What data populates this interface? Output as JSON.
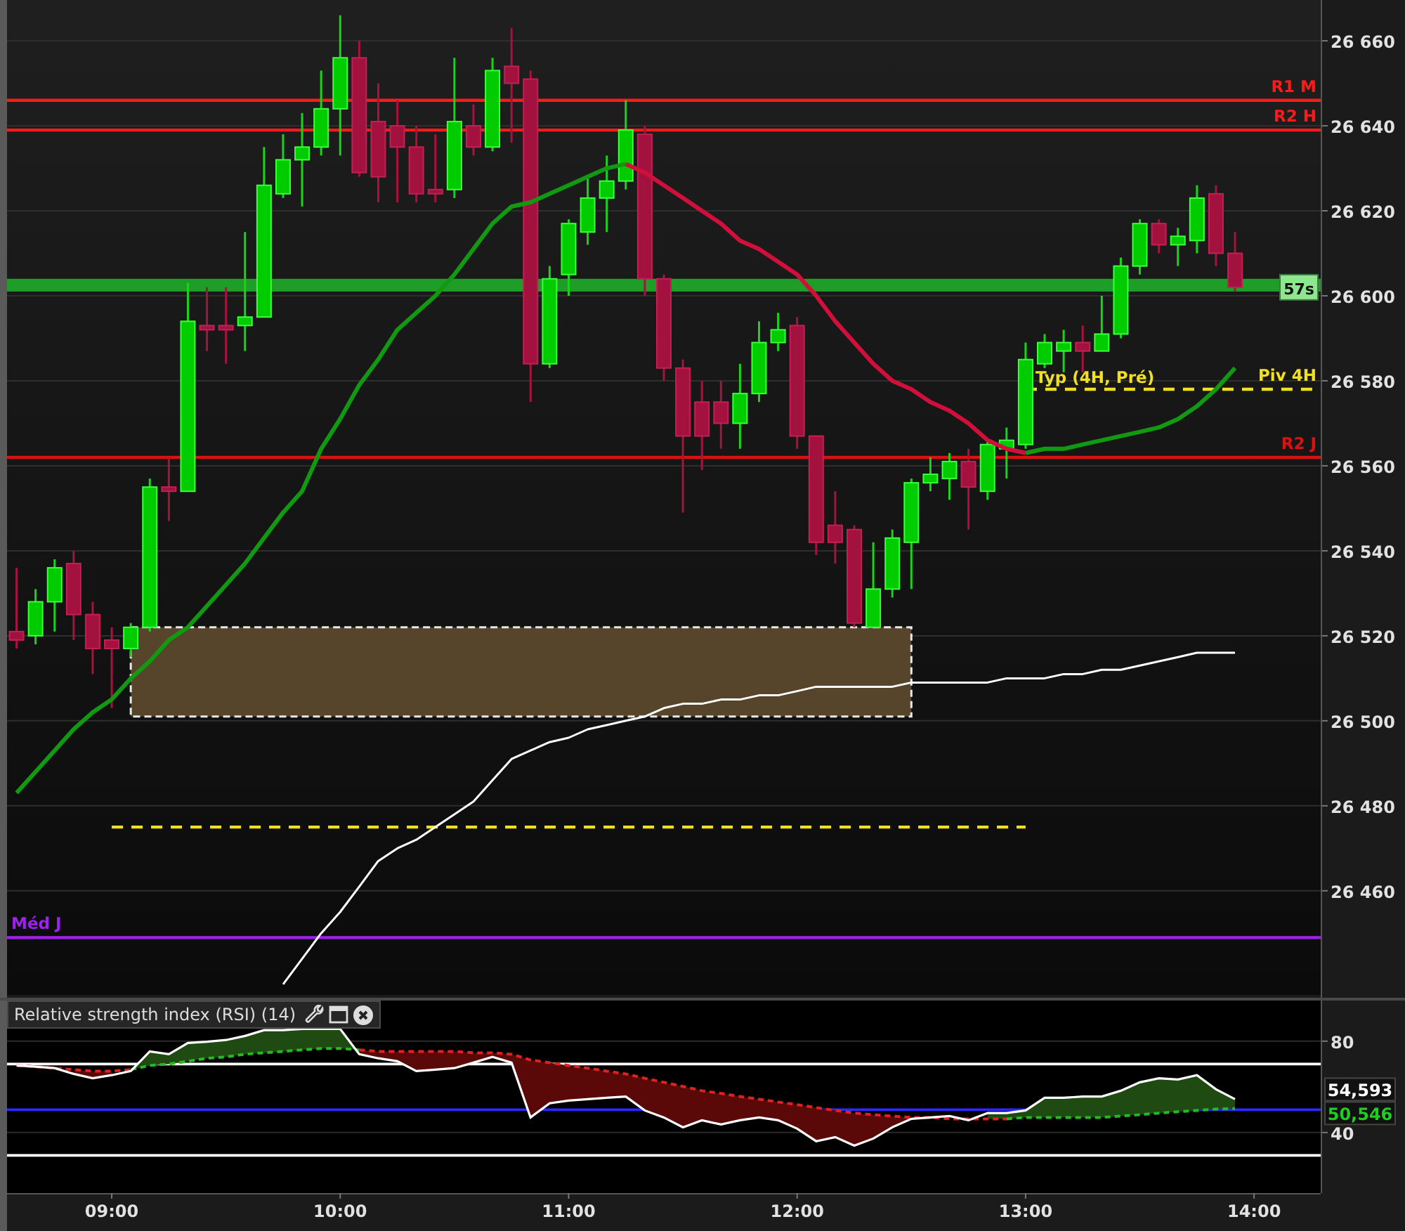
{
  "price_chart": {
    "countdown": {
      "text": "57s"
    },
    "chart_data": {
      "type": "candlestick",
      "grid": true,
      "x": [
        515,
        520,
        525,
        530,
        535,
        540,
        545,
        550,
        555,
        560,
        565,
        570,
        575,
        580,
        585,
        590,
        595,
        600,
        605,
        610,
        615,
        620,
        625,
        630,
        635,
        640,
        645,
        650,
        655,
        660,
        665,
        670,
        675,
        680,
        685,
        690,
        695,
        700,
        705,
        710,
        715,
        720,
        725,
        730,
        735,
        740,
        745,
        750,
        755,
        760,
        765,
        770,
        775,
        780,
        785,
        790,
        795,
        800,
        805,
        810,
        815,
        820,
        825,
        830,
        835
      ],
      "xlim": [
        512.5,
        857.5
      ],
      "ylim": [
        26435.5,
        26669.6
      ],
      "yticks": [
        {
          "value": 26660,
          "label": "26 660"
        },
        {
          "value": 26640,
          "label": "26 640"
        },
        {
          "value": 26620,
          "label": "26 620"
        },
        {
          "value": 26600,
          "label": "26 600"
        },
        {
          "value": 26580,
          "label": "26 580"
        },
        {
          "value": 26560,
          "label": "26 560"
        },
        {
          "value": 26540,
          "label": "26 540"
        },
        {
          "value": 26520,
          "label": "26 520"
        },
        {
          "value": 26500,
          "label": "26 500"
        },
        {
          "value": 26480,
          "label": "26 480"
        },
        {
          "value": 26460,
          "label": "26 460"
        }
      ],
      "ohlc": [
        [
          26521,
          26536,
          26517,
          26519
        ],
        [
          26520,
          26531,
          26518,
          26528
        ],
        [
          26528,
          26538,
          26521,
          26536
        ],
        [
          26537,
          26540,
          26519,
          26525
        ],
        [
          26525,
          26528,
          26511,
          26517
        ],
        [
          26519,
          26522,
          26503,
          26517
        ],
        [
          26517,
          26523,
          26515,
          26522
        ],
        [
          26522,
          26557,
          26521,
          26555
        ],
        [
          26555,
          26562,
          26547,
          26554
        ],
        [
          26554,
          26603,
          26554,
          26594
        ],
        [
          26593,
          26602,
          26587,
          26592
        ],
        [
          26593,
          26602,
          26584,
          26592
        ],
        [
          26593,
          26615,
          26587,
          26595
        ],
        [
          26595,
          26635,
          26595,
          26626
        ],
        [
          26624,
          26638,
          26623,
          26632
        ],
        [
          26632,
          26643,
          26621,
          26635
        ],
        [
          26635,
          26653,
          26633,
          26644
        ],
        [
          26644,
          26666,
          26633,
          26656
        ],
        [
          26656,
          26660,
          26628,
          26629
        ],
        [
          26641,
          26650,
          26622,
          26628
        ],
        [
          26640,
          26646,
          26622,
          26635
        ],
        [
          26635,
          26640,
          26622,
          26624
        ],
        [
          26625,
          26638,
          26622,
          26624
        ],
        [
          26625,
          26656,
          26623,
          26641
        ],
        [
          26640,
          26645,
          26633,
          26635
        ],
        [
          26635,
          26656,
          26634,
          26653
        ],
        [
          26654,
          26663,
          26636,
          26650
        ],
        [
          26651,
          26653,
          26575,
          26584
        ],
        [
          26584,
          26607,
          26583,
          26604
        ],
        [
          26605,
          26618,
          26600,
          26617
        ],
        [
          26615,
          26628,
          26612,
          26623
        ],
        [
          26623,
          26633,
          26615,
          26627
        ],
        [
          26627,
          26646,
          26625,
          26639
        ],
        [
          26638,
          26640,
          26600,
          26604
        ],
        [
          26604,
          26605,
          26580,
          26583
        ],
        [
          26583,
          26585,
          26549,
          26567
        ],
        [
          26575,
          26580,
          26559,
          26567
        ],
        [
          26575,
          26580,
          26564,
          26570
        ],
        [
          26570,
          26584,
          26564,
          26577
        ],
        [
          26577,
          26594,
          26575,
          26589
        ],
        [
          26589,
          26596,
          26587,
          26592
        ],
        [
          26593,
          26595,
          26564,
          26567
        ],
        [
          26567,
          26567,
          26539,
          26542
        ],
        [
          26546,
          26554,
          26537,
          26542
        ],
        [
          26545,
          26546,
          26522,
          26523
        ],
        [
          26522,
          26542,
          26522,
          26531
        ],
        [
          26531,
          26545,
          26529,
          26543
        ],
        [
          26542,
          26557,
          26531,
          26556
        ],
        [
          26556,
          26562,
          26554,
          26558
        ],
        [
          26557,
          26563,
          26552,
          26561
        ],
        [
          26561,
          26564,
          26545,
          26555
        ],
        [
          26554,
          26566,
          26552,
          26565
        ],
        [
          26564,
          26569,
          26557,
          26566
        ],
        [
          26565,
          26589,
          26564,
          26585
        ],
        [
          26584,
          26591,
          26583,
          26589
        ],
        [
          26587,
          26592,
          26582,
          26589
        ],
        [
          26589,
          26593,
          26582,
          26587
        ],
        [
          26587,
          26600,
          26587,
          26591
        ],
        [
          26591,
          26609,
          26590,
          26607
        ],
        [
          26607,
          26618,
          26605,
          26617
        ],
        [
          26617,
          26618,
          26610,
          26612
        ],
        [
          26612,
          26616,
          26607,
          26614
        ],
        [
          26613,
          26626,
          26610,
          26623
        ],
        [
          26624,
          26626,
          26607,
          26610
        ],
        [
          26610,
          26615,
          26601,
          26602
        ]
      ],
      "series": [
        {
          "type": "line",
          "color": "#119a11",
          "values": [
            26483,
            26488,
            26493,
            26498,
            26502,
            26505,
            26510,
            26514,
            26519,
            26522,
            26527,
            26532,
            26537,
            26543,
            26549,
            26554,
            26564,
            26571,
            26579,
            26585,
            26592,
            26596,
            26600,
            26605,
            26611,
            26617,
            26621,
            26622,
            26624,
            26626,
            26628,
            26630,
            26631,
            null,
            null,
            null,
            null,
            null,
            null,
            null,
            null,
            null,
            null,
            null,
            null,
            null,
            null,
            null,
            null,
            null,
            null,
            null,
            null,
            26563,
            26564,
            26564,
            26565,
            26566,
            26567,
            26568,
            26569,
            26571,
            26574,
            26578,
            26583
          ]
        },
        {
          "type": "line",
          "color": "#d0103a",
          "values": [
            null,
            null,
            null,
            null,
            null,
            null,
            null,
            null,
            null,
            null,
            null,
            null,
            null,
            null,
            null,
            null,
            null,
            null,
            null,
            null,
            null,
            null,
            null,
            null,
            null,
            null,
            null,
            null,
            null,
            null,
            null,
            null,
            26631,
            26629,
            26626,
            26623,
            26620,
            26617,
            26613,
            26611,
            26608,
            26605,
            26600,
            26594,
            26589,
            26584,
            26580,
            26578,
            26575,
            26573,
            26570,
            26566,
            26564,
            26563,
            null,
            null,
            null,
            null,
            null,
            null,
            null,
            null,
            null,
            null,
            null
          ]
        },
        {
          "type": "line",
          "color": "#ffffff",
          "values": [
            null,
            null,
            null,
            null,
            null,
            null,
            null,
            null,
            null,
            null,
            null,
            null,
            null,
            null,
            26438,
            26444,
            26450,
            26455,
            26461,
            26467,
            26470,
            26472,
            26475,
            26478,
            26481,
            26486,
            26491,
            26493,
            26495,
            26496,
            26498,
            26499,
            26500,
            26501,
            26503,
            26504,
            26504,
            26505,
            26505,
            26506,
            26506,
            26507,
            26508,
            26508,
            26508,
            26508,
            26508,
            26509,
            26509,
            26509,
            26509,
            26509,
            26510,
            26510,
            26510,
            26511,
            26511,
            26512,
            26512,
            26513,
            26514,
            26515,
            26516,
            26516,
            26516
          ]
        }
      ],
      "bands": [
        {
          "axis": "y",
          "from": 26501,
          "to": 26522,
          "color": "#56452a"
        },
        {
          "axis": "y",
          "from": 26601,
          "to": 26604,
          "color": "#1e9e28"
        }
      ],
      "ref_lines": [
        {
          "axis": "y",
          "value": 26646,
          "label": "R1 M",
          "color": "#ff1a1a"
        },
        {
          "axis": "y",
          "value": 26639,
          "label": "R2 H",
          "color": "#ff1a1a"
        },
        {
          "axis": "y",
          "value": 26578,
          "label": "Piv 4H",
          "color": "#f0e020",
          "line_style": "dashed"
        },
        {
          "axis": "y",
          "value": 26562,
          "label": "R2 J",
          "color": "#e01010"
        },
        {
          "axis": "y",
          "value": 26475,
          "color": "#f0e020",
          "line_style": "dashed"
        },
        {
          "axis": "y",
          "value": 26449,
          "label": "Méd J",
          "color": "#a020f0"
        }
      ],
      "annotations": [
        {
          "text": "Typ (4H, Pré)",
          "x": 780,
          "y": 26579.5
        }
      ]
    }
  },
  "rsi_panel": {
    "title": "Relative strength index (RSI) (14)",
    "readings": [
      {
        "text": "54,593",
        "color": "#ffffff"
      },
      {
        "text": "50,546",
        "color": "#22cc22"
      }
    ],
    "chart_data": {
      "type": "line",
      "grid": true,
      "x": [
        515,
        520,
        525,
        530,
        535,
        540,
        545,
        550,
        555,
        560,
        565,
        570,
        575,
        580,
        585,
        590,
        595,
        600,
        605,
        610,
        615,
        620,
        625,
        630,
        635,
        640,
        645,
        650,
        655,
        660,
        665,
        670,
        675,
        680,
        685,
        690,
        695,
        700,
        705,
        710,
        715,
        720,
        725,
        730,
        735,
        740,
        745,
        750,
        755,
        760,
        765,
        770,
        775,
        780,
        785,
        790,
        795,
        800,
        805,
        810,
        815,
        820,
        825,
        830,
        835
      ],
      "xlim": [
        512.5,
        857.5
      ],
      "ylim": [
        13.5,
        97.8
      ],
      "xticks": [
        {
          "value": 540,
          "label": "09:00"
        },
        {
          "value": 600,
          "label": "10:00"
        },
        {
          "value": 660,
          "label": "11:00"
        },
        {
          "value": 720,
          "label": "12:00"
        },
        {
          "value": 780,
          "label": "13:00"
        },
        {
          "value": 840,
          "label": "14:00"
        }
      ],
      "yticks": [
        80,
        40
      ],
      "series": [
        {
          "color": "#ffffff",
          "values": [
            69.4,
            68.8,
            68.2,
            65.7,
            63.8,
            65.1,
            66.9,
            75.5,
            74.3,
            79.2,
            79.8,
            80.5,
            82.3,
            84.8,
            84.8,
            85.4,
            85.4,
            85.4,
            74.3,
            72.5,
            71.2,
            66.9,
            67.5,
            68.2,
            70.6,
            73.1,
            70.6,
            46.6,
            52.8,
            54.0,
            54.6,
            55.2,
            55.8,
            49.7,
            46.6,
            42.3,
            45.4,
            43.5,
            45.4,
            46.6,
            45.4,
            41.7,
            36.2,
            38.0,
            34.3,
            37.4,
            42.3,
            46.0,
            46.6,
            47.2,
            45.4,
            48.5,
            48.5,
            49.7,
            55.2,
            55.2,
            55.8,
            55.8,
            58.3,
            62.0,
            63.8,
            63.2,
            65.1,
            58.9,
            54.6
          ]
        },
        {
          "color": "#22bb22",
          "line_style": "dashed",
          "values": [
            null,
            null,
            null,
            null,
            null,
            null,
            67.5,
            69.4,
            70.0,
            71.2,
            72.5,
            73.1,
            74.3,
            74.9,
            75.5,
            76.2,
            76.8,
            76.8,
            76.2,
            null,
            null,
            null,
            null,
            null,
            null,
            null,
            null,
            null,
            null,
            null,
            null,
            null,
            null,
            null,
            null,
            null,
            null,
            null,
            null,
            null,
            null,
            null,
            null,
            null,
            null,
            null,
            null,
            null,
            null,
            null,
            null,
            null,
            46.0,
            46.6,
            46.6,
            46.6,
            46.6,
            46.6,
            47.2,
            47.8,
            48.5,
            49.1,
            49.7,
            50.3,
            50.5
          ]
        },
        {
          "color": "#dd2222",
          "line_style": "dashed",
          "values": [
            69.4,
            68.8,
            68.2,
            67.5,
            66.9,
            66.9,
            67.5,
            null,
            null,
            null,
            null,
            null,
            null,
            null,
            null,
            null,
            null,
            null,
            76.2,
            75.5,
            75.5,
            75.5,
            75.5,
            75.5,
            74.9,
            74.9,
            74.3,
            71.8,
            70.6,
            69.4,
            68.2,
            66.9,
            65.7,
            63.8,
            62.0,
            60.2,
            58.3,
            57.1,
            55.8,
            54.6,
            53.4,
            52.2,
            50.9,
            49.7,
            48.5,
            47.8,
            47.2,
            46.6,
            46.6,
            46.0,
            46.0,
            46.0,
            46.0,
            null,
            null,
            null,
            null,
            null,
            null,
            null,
            null,
            null,
            null,
            null,
            null
          ]
        }
      ],
      "ref_lines": [
        {
          "axis": "y",
          "value": 70,
          "color": "#ffffff"
        },
        {
          "axis": "y",
          "value": 50,
          "color": "#2a2aff"
        },
        {
          "axis": "y",
          "value": 30,
          "color": "#ffffff"
        }
      ]
    }
  }
}
